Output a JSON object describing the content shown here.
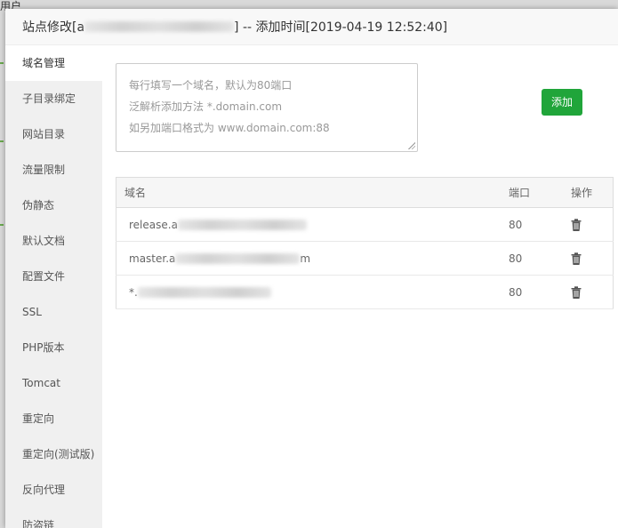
{
  "background": {
    "corner_text": "用户"
  },
  "dialog": {
    "title_prefix": "站点修改[a",
    "title_suffix": "] -- 添加时间[2019-04-19 12:52:40]"
  },
  "sidebar": {
    "items": [
      {
        "label": "域名管理",
        "active": true
      },
      {
        "label": "子目录绑定"
      },
      {
        "label": "网站目录"
      },
      {
        "label": "流量限制"
      },
      {
        "label": "伪静态"
      },
      {
        "label": "默认文档"
      },
      {
        "label": "配置文件"
      },
      {
        "label": "SSL"
      },
      {
        "label": "PHP版本"
      },
      {
        "label": "Tomcat"
      },
      {
        "label": "重定向"
      },
      {
        "label": "重定向(测试版)"
      },
      {
        "label": "反向代理"
      },
      {
        "label": "防盗链"
      }
    ]
  },
  "domain_form": {
    "placeholder_lines": [
      "每行填写一个域名，默认为80端口",
      "泛解析添加方法 *.domain.com",
      "如另加端口格式为 www.domain.com:88"
    ],
    "add_label": "添加"
  },
  "domain_table": {
    "headers": {
      "domain": "域名",
      "port": "端口",
      "action": "操作"
    },
    "rows": [
      {
        "domain_prefix": "release.a",
        "domain_suffix": "",
        "port": "80"
      },
      {
        "domain_prefix": "master.a",
        "domain_suffix": "m",
        "port": "80"
      },
      {
        "domain_prefix": "*.",
        "domain_suffix": "",
        "port": "80"
      }
    ]
  },
  "colors": {
    "accent": "#20a53a"
  }
}
